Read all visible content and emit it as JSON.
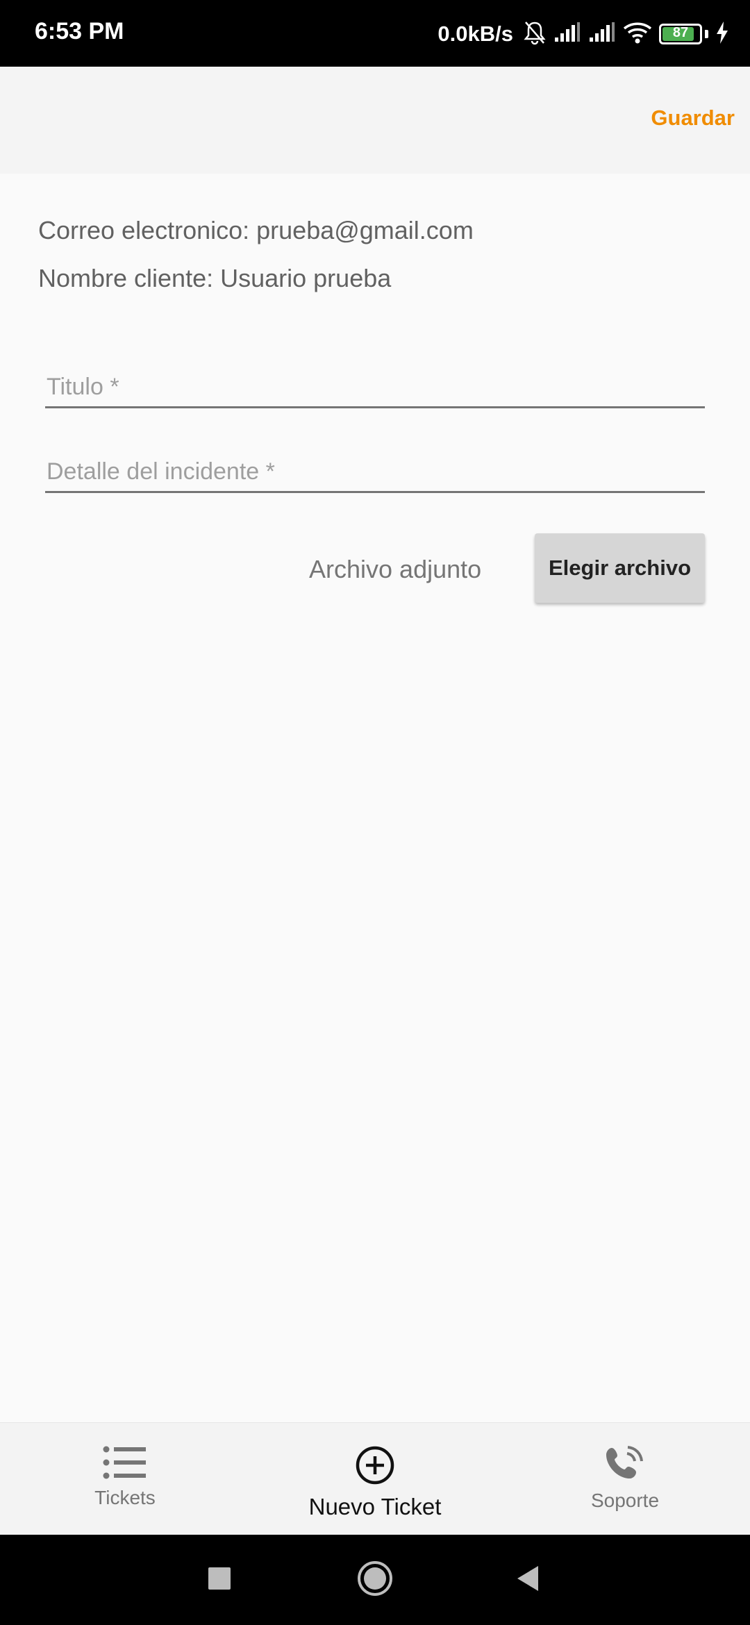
{
  "status_bar": {
    "time": "6:53 PM",
    "network_speed": "0.0kB/s",
    "battery_level": "87",
    "battery_percent": 87
  },
  "app_bar": {
    "save_label": "Guardar",
    "accent_color": "#f08c00"
  },
  "user_info": {
    "email_line": "Correo electronico: prueba@gmail.com",
    "name_line": "Nombre cliente: Usuario prueba"
  },
  "form": {
    "title_placeholder": "Titulo *",
    "title_value": "",
    "detail_placeholder": "Detalle del incidente *",
    "detail_value": "",
    "attachment_label": "Archivo adjunto",
    "choose_file_label": "Elegir archivo"
  },
  "bottom_nav": {
    "items": [
      {
        "label": "Tickets",
        "icon": "list-icon",
        "active": false
      },
      {
        "label": "Nuevo Ticket",
        "icon": "add-circle-icon",
        "active": true
      },
      {
        "label": "Soporte",
        "icon": "phone-icon",
        "active": false
      }
    ]
  },
  "system_nav": {
    "items": [
      "recents-icon",
      "home-icon",
      "back-icon"
    ]
  }
}
